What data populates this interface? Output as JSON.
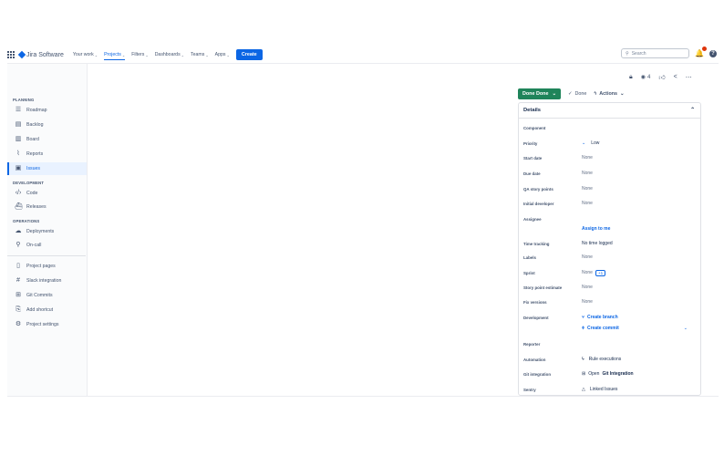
{
  "topnav": {
    "app_name": "Jira Software",
    "items": [
      {
        "label": "Your work",
        "active": false
      },
      {
        "label": "Projects",
        "active": true
      },
      {
        "label": "Filters",
        "active": false
      },
      {
        "label": "Dashboards",
        "active": false
      },
      {
        "label": "Teams",
        "active": false
      },
      {
        "label": "Apps",
        "active": false
      }
    ],
    "create_label": "Create",
    "search_placeholder": "Search",
    "help_label": "?"
  },
  "sidebar": {
    "planning_title": "PLANNING",
    "planning": [
      "Roadmap",
      "Backlog",
      "Board",
      "Reports",
      "Issues"
    ],
    "development_title": "DEVELOPMENT",
    "development": [
      "Code",
      "Releases"
    ],
    "operations_title": "OPERATIONS",
    "operations": [
      "Deployments",
      "On-call"
    ],
    "other": [
      "Project pages",
      "Slack integration",
      "Git Commits",
      "Add shortcut",
      "Project settings"
    ],
    "active_item": "Issues"
  },
  "issue": {
    "watch_count": "4",
    "status_label": "Done Done",
    "done_label": "Done",
    "actions_label": "Actions"
  },
  "details": {
    "title": "Details",
    "fields": {
      "component": {
        "label": "Component",
        "value": ""
      },
      "priority": {
        "label": "Priority",
        "value": "Low"
      },
      "start_date": {
        "label": "Start date",
        "value": "None"
      },
      "due_date": {
        "label": "Due date",
        "value": "None"
      },
      "qa_story_points": {
        "label": "QA story points",
        "value": "None"
      },
      "initial_developer": {
        "label": "Initial developer",
        "value": "None"
      },
      "assignee": {
        "label": "Assignee",
        "value": "Assign to me"
      },
      "time_tracking": {
        "label": "Time tracking",
        "value": "No time logged"
      },
      "labels": {
        "label": "Labels",
        "value": "None"
      },
      "sprint": {
        "label": "Sprint",
        "value": "None",
        "extra": "+1"
      },
      "story_point_estimate": {
        "label": "Story point estimate",
        "value": "None"
      },
      "fix_versions": {
        "label": "Fix versions",
        "value": "None"
      },
      "development": {
        "label": "Development",
        "value": "Create branch",
        "value2": "Create commit"
      },
      "reporter": {
        "label": "Reporter",
        "value": ""
      },
      "automation": {
        "label": "Automation",
        "value": "Rule executions"
      },
      "git_integration": {
        "label": "Git integration",
        "value_prefix": "Open",
        "value_strong": "Git Integration"
      },
      "sentry": {
        "label": "Sentry",
        "value": "Linked Issues"
      }
    }
  },
  "colors": {
    "primary": "#0c66e4",
    "done": "#1f845a",
    "notification": "#de350b"
  }
}
